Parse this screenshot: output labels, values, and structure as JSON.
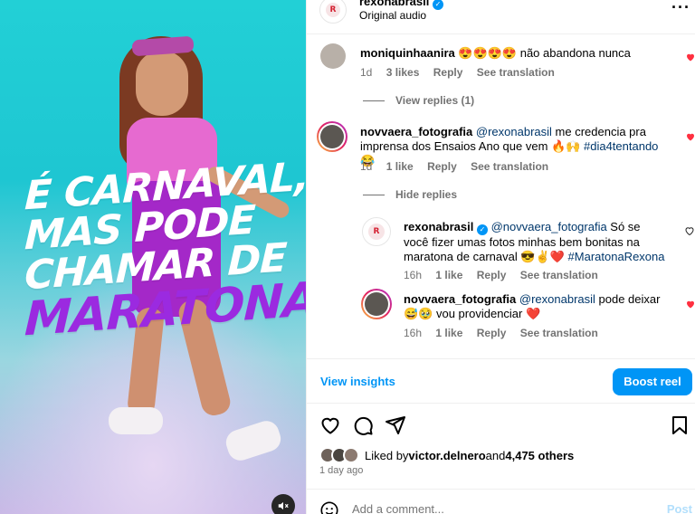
{
  "media": {
    "overlay_lines": [
      "É CARNAVAL,",
      "MAS PODE",
      "CHAMAR DE",
      "MARATONA"
    ],
    "text_colors": {
      "white": "#ffffff",
      "accent": "#9b2ae0"
    }
  },
  "header": {
    "username": "rexonabrasil",
    "subtitle": "Original audio",
    "more_icon": "more-horizontal-icon"
  },
  "comments": [
    {
      "username": "moniquinhaanira",
      "text": "😍😍😍😍 não abandona nunca",
      "age": "1d",
      "likes": "3 likes",
      "reply": "Reply",
      "translate": "See translation",
      "toggle": "View replies (1)"
    },
    {
      "username": "novvaera_fotografia",
      "mention": "@rexonabrasil",
      "text": " me credencia pra imprensa dos Ensaios Ano que vem 🔥🙌",
      "hashtag": " #dia4tentando",
      "text_end": " 😂",
      "age": "1d",
      "likes": "1 like",
      "reply": "Reply",
      "translate": "See translation",
      "toggle": "Hide replies"
    }
  ],
  "replies": [
    {
      "username": "rexonabrasil",
      "mention": "@novvaera_fotografia",
      "text": " Só se você fizer umas fotos minhas bem bonitas na maratona de carnaval 😎✌️❤️",
      "hashtag": " #MaratonaRexona",
      "age": "16h",
      "likes": "1 like",
      "reply": "Reply",
      "translate": "See translation"
    },
    {
      "username": "novvaera_fotografia",
      "mention": "@rexonabrasil",
      "text": " pode deixar 😅🥹 vou providenciar ❤️",
      "age": "16h",
      "likes": "1 like",
      "reply": "Reply",
      "translate": "See translation"
    }
  ],
  "insights": {
    "link": "View insights",
    "boost": "Boost reel"
  },
  "engagement": {
    "liked_prefix": "Liked by ",
    "liked_user": "victor.delnero",
    "liked_and": " and ",
    "liked_count": "4,475 others",
    "time_ago": "1 day ago"
  },
  "composer": {
    "placeholder": "Add a comment...",
    "post": "Post"
  },
  "colors": {
    "blue": "#0095f6",
    "like_red": "#ff3040",
    "muted": "#737373"
  }
}
